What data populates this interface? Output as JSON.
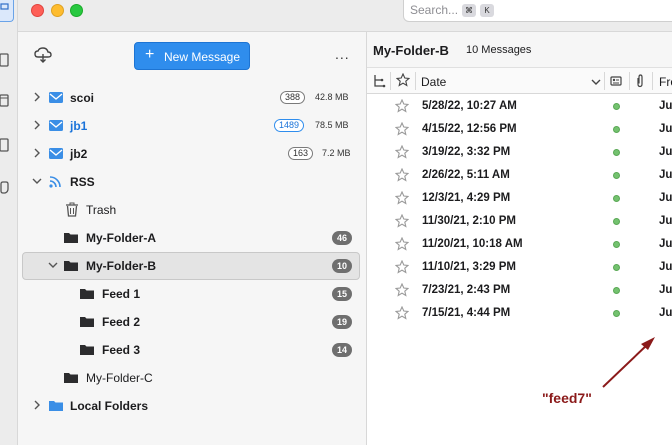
{
  "search": {
    "placeholder": "Search...",
    "kbd1": "⌘",
    "kbd2": "K"
  },
  "toolbar": {
    "new_message_label": "New Message",
    "more_label": "..."
  },
  "folders": [
    {
      "name": "scoi",
      "count": "388",
      "size": "42.8 MB"
    },
    {
      "name": "jb1",
      "count": "1489",
      "size": "78.5 MB"
    },
    {
      "name": "jb2",
      "count": "163",
      "size": "7.2 MB"
    },
    {
      "name": "RSS"
    },
    {
      "name": "Trash"
    },
    {
      "name": "My-Folder-A",
      "count": "46"
    },
    {
      "name": "My-Folder-B",
      "count": "10"
    },
    {
      "name": "Feed 1",
      "count": "15"
    },
    {
      "name": "Feed 2",
      "count": "19"
    },
    {
      "name": "Feed 3",
      "count": "14"
    },
    {
      "name": "My-Folder-C"
    },
    {
      "name": "Local Folders"
    }
  ],
  "message_list": {
    "folder": "My-Folder-B",
    "count_label": "10 Messages",
    "columns": {
      "date": "Date",
      "from": "Fro"
    },
    "rows": [
      {
        "date": "5/28/22, 10:27 AM",
        "from": "Ju"
      },
      {
        "date": "4/15/22, 12:56 PM",
        "from": "Ju"
      },
      {
        "date": "3/19/22, 3:32 PM",
        "from": "Ju"
      },
      {
        "date": "2/26/22, 5:11 AM",
        "from": "Ju"
      },
      {
        "date": "12/3/21, 4:29 PM",
        "from": "Ju"
      },
      {
        "date": "11/30/21, 2:10 PM",
        "from": "Ju"
      },
      {
        "date": "11/20/21, 10:18 AM",
        "from": "Ju"
      },
      {
        "date": "11/10/21, 3:29 PM",
        "from": "Ju"
      },
      {
        "date": "7/23/21, 2:43 PM",
        "from": "Ju"
      },
      {
        "date": "7/15/21, 4:44 PM",
        "from": "Ju"
      }
    ]
  },
  "annotation": {
    "text": "\"feed7\""
  },
  "colors": {
    "accent": "#2f8ded",
    "annotation": "#8b1a1a",
    "status_dot": "#74c26f"
  }
}
